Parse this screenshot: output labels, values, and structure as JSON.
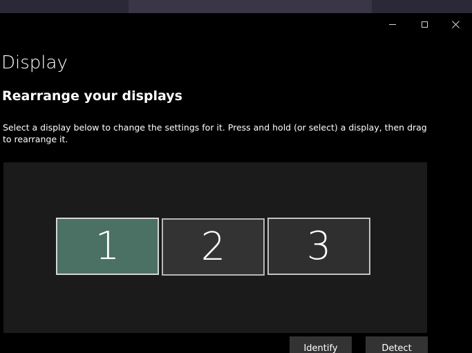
{
  "window": {
    "title": "Display"
  },
  "section": {
    "heading": "Rearrange your displays",
    "description": "Select a display below to change the settings for it. Press and hold (or select) a display, then drag to rearrange it."
  },
  "displays": [
    {
      "label": "1",
      "selected": true
    },
    {
      "label": "2",
      "selected": false
    },
    {
      "label": "3",
      "selected": false
    }
  ],
  "actions": {
    "identify_label": "Identify",
    "detect_label": "Detect"
  },
  "colors": {
    "selected_display": "#4b7064",
    "unselected_display": "#333333",
    "canvas_background": "#1b1b1b",
    "button_background": "#333333"
  },
  "icons": {
    "minimize": "minimize-icon",
    "maximize": "maximize-icon",
    "close": "close-icon"
  }
}
